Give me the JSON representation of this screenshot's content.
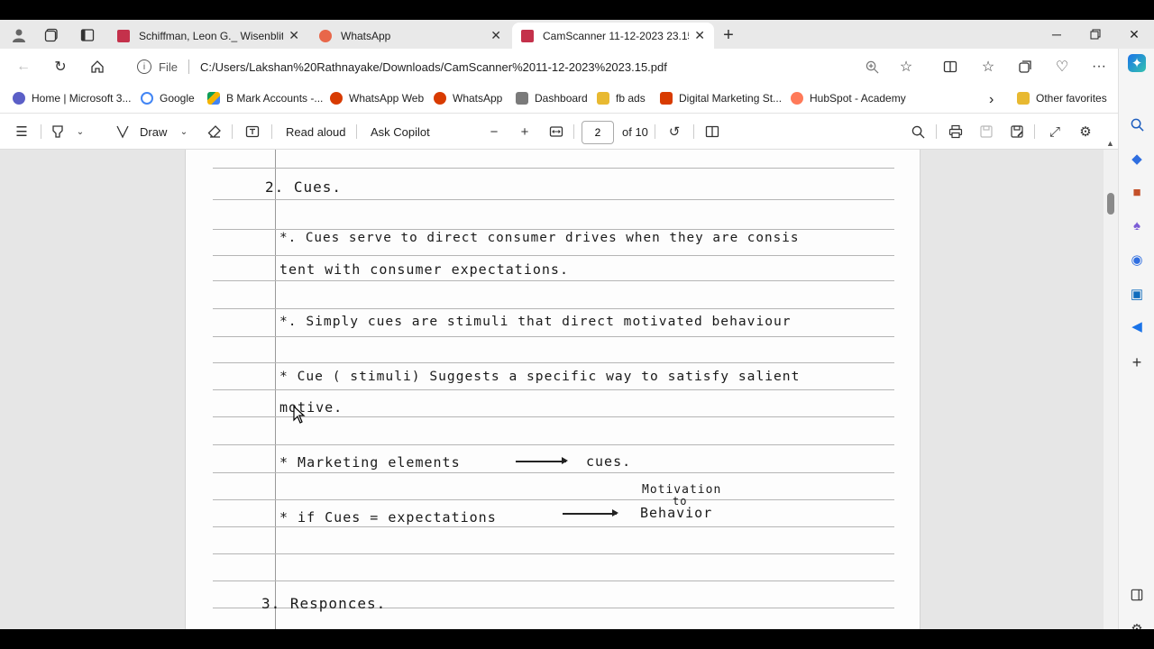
{
  "tabs": [
    {
      "title": "Schiffman, Leon G._ Wisenblit, Jo",
      "icon": "pdf-icon"
    },
    {
      "title": "WhatsApp",
      "icon": "whatsapp-alert-icon"
    },
    {
      "title": "CamScanner 11-12-2023 23.15.p",
      "icon": "pdf-icon",
      "active": true
    }
  ],
  "address": {
    "file_label": "File",
    "url": "C:/Users/Lakshan%20Rathnayake/Downloads/CamScanner%2011-12-2023%2023.15.pdf"
  },
  "favorites": [
    {
      "label": "Home | Microsoft 3...",
      "color": "#5b5fc7"
    },
    {
      "label": "Google",
      "color": "#4285f4"
    },
    {
      "label": "B Mark Accounts -...",
      "color": "#f4b400"
    },
    {
      "label": "WhatsApp Web",
      "color": "#d83b01"
    },
    {
      "label": "WhatsApp",
      "color": "#d83b01"
    },
    {
      "label": "Dashboard",
      "color": "#7a7a7a"
    },
    {
      "label": "fb ads",
      "color": "#e8b931"
    },
    {
      "label": "Digital Marketing St...",
      "color": "#d83b01"
    },
    {
      "label": "HubSpot - Academy",
      "color": "#ff7a59"
    }
  ],
  "other_favorites": "Other favorites",
  "pdf_toolbar": {
    "draw": "Draw",
    "read_aloud": "Read aloud",
    "ask_copilot": "Ask Copilot",
    "page": "2",
    "of_pages": "of 10"
  },
  "document": {
    "heading_cues": "2. Cues.",
    "line1a": "*. Cues  serve  to  direct  consumer  drives  when  they  are  consis",
    "line1b": "tent  with  consumer  expectations.",
    "line2": "*. Simply  cues  are  stimuli  that  direct  motivated  behaviour",
    "line3a": "* Cue ( stimuli)  Suggests  a  specific  way  to  satisfy  salient",
    "line3b": "motive.",
    "line4_left": "* Marketing  elements",
    "line4_right": "cues.",
    "line5_left": "*  if   Cues  =  expectations",
    "line5_top": "Motivation",
    "line5_mid": "to",
    "line5_right": "Behavior",
    "heading_responses": "3. Responces."
  }
}
